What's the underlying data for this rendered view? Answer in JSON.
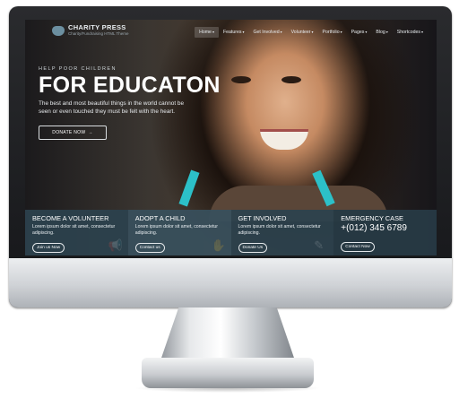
{
  "logo": {
    "title": "CHARITY PRESS",
    "subtitle": "Charity/Fundraising HTML Theme"
  },
  "nav": [
    {
      "label": "Home",
      "active": true
    },
    {
      "label": "Features",
      "active": false
    },
    {
      "label": "Get Involved",
      "active": false
    },
    {
      "label": "Volunteer",
      "active": false
    },
    {
      "label": "Portfolio",
      "active": false
    },
    {
      "label": "Pages",
      "active": false
    },
    {
      "label": "Blog",
      "active": false
    },
    {
      "label": "Shortcodes",
      "active": false
    }
  ],
  "hero": {
    "kicker": "HELP POOR CHILDREN",
    "headline": "FOR EDUCATON",
    "description": "The best and most beautiful things in the world cannot be seen or even touched they must be felt with the heart.",
    "button_label": "DONATE NOW"
  },
  "panels": [
    {
      "title": "BECOME A VOLUNTEER",
      "text": "Lorem ipsum dolor sit amet, consectetur adipiscing.",
      "button": "Join us Now",
      "icon": "megaphone-icon"
    },
    {
      "title": "ADOPT A CHILD",
      "text": "Lorem ipsum dolor sit amet, consectetur adipiscing.",
      "button": "Contact us",
      "icon": "hands-icon"
    },
    {
      "title": "GET INVOLVED",
      "text": "Lorem ipsum dolor sit amet, consectetur adipiscing.",
      "button": "Donate Us",
      "icon": "pen-icon"
    },
    {
      "title": "EMERGENCY CASE",
      "phone": "+(012) 345 6789",
      "button": "Contact Now"
    }
  ]
}
